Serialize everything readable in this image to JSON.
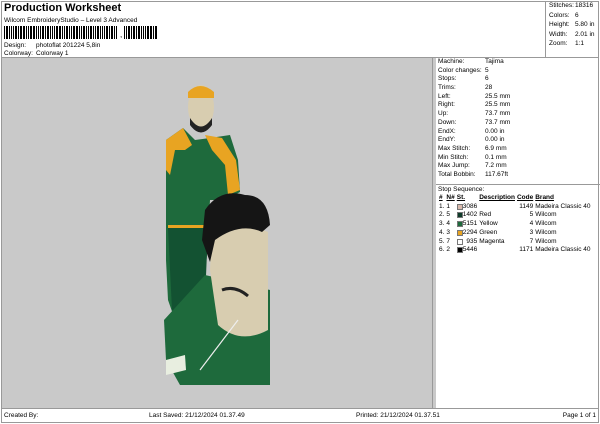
{
  "header": {
    "title": "Production Worksheet",
    "subtitle": "Wilcom EmbroideryStudio – Level 3 Advanced",
    "barcode_suffix": ",",
    "design_label": "Design:",
    "design_value": "photoflat 201224 5,8in",
    "colorway_label": "Colorway:",
    "colorway_value": "Colorway 1"
  },
  "stats": [
    {
      "k": "Stitches:",
      "v": "18316"
    },
    {
      "k": "Colors:",
      "v": "6"
    },
    {
      "k": "Height:",
      "v": "5.80 in"
    },
    {
      "k": "Width:",
      "v": "2.01 in"
    },
    {
      "k": "Zoom:",
      "v": "1:1"
    }
  ],
  "info": [
    {
      "k": "Machine:",
      "v": "Tajima"
    },
    {
      "k": "Color changes:",
      "v": "5"
    },
    {
      "k": "Stops:",
      "v": "6"
    },
    {
      "k": "Trims:",
      "v": "28"
    },
    {
      "k": "Left:",
      "v": "25.5 mm"
    },
    {
      "k": "Right:",
      "v": "25.5 mm"
    },
    {
      "k": "Up:",
      "v": "73.7 mm"
    },
    {
      "k": "Down:",
      "v": "73.7 mm"
    },
    {
      "k": "EndX:",
      "v": "0.00 in"
    },
    {
      "k": "EndY:",
      "v": "0.00 in"
    },
    {
      "k": "Max Stitch:",
      "v": "6.9 mm"
    },
    {
      "k": "Min Stitch:",
      "v": "0.1 mm"
    },
    {
      "k": "Max Jump:",
      "v": "7.2 mm"
    },
    {
      "k": "Total Bobbin:",
      "v": "117.67ft"
    }
  ],
  "sequence": {
    "title": "Stop Sequence:",
    "columns": [
      "#",
      "N#",
      "St.",
      "Description",
      "Code",
      "Brand"
    ],
    "rows": [
      {
        "n": "1.",
        "nn": "1",
        "color": "#d9b9ac",
        "st": "3086",
        "desc": "",
        "code": "1149",
        "brand": "Madeira Classic 40"
      },
      {
        "n": "2.",
        "nn": "5",
        "color": "#0f3b2a",
        "st": "1402",
        "desc": "Red",
        "code": "5",
        "brand": "Wilcom"
      },
      {
        "n": "3.",
        "nn": "4",
        "color": "#1e6a3c",
        "st": "5151",
        "desc": "Yellow",
        "code": "4",
        "brand": "Wilcom"
      },
      {
        "n": "4.",
        "nn": "3",
        "color": "#e8a422",
        "st": "2294",
        "desc": "Green",
        "code": "3",
        "brand": "Wilcom"
      },
      {
        "n": "5.",
        "nn": "7",
        "color": "#ffffff",
        "st": "935",
        "desc": "Magenta",
        "code": "7",
        "brand": "Wilcom"
      },
      {
        "n": "6.",
        "nn": "2",
        "color": "#000000",
        "st": "5446",
        "desc": "",
        "code": "1171",
        "brand": "Madeira Classic 40"
      }
    ]
  },
  "footer": {
    "created": "Created By:",
    "saved": "Last Saved: 21/12/2024 01.37.49",
    "printed": "Printed: 21/12/2024 01.37.51",
    "page": "Page 1 of 1"
  }
}
